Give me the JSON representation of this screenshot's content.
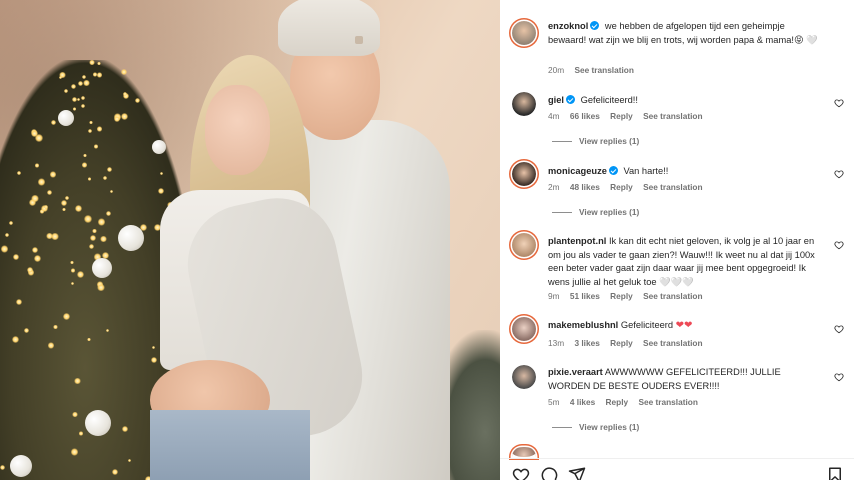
{
  "post": {
    "caption_user": "enzoknol",
    "caption_text": "we hebben de afgelopen tijd een geheimpje bewaard! wat zijn we blij en trots, wij worden papa & mama!😝 🤍",
    "caption_time": "20m",
    "see_translation": "See translation"
  },
  "comments": [
    {
      "user": "giel",
      "verified": true,
      "text": "Gefeliciteerd!!",
      "time": "4m",
      "likes": "66 likes",
      "reply": "Reply",
      "translate": "See translation",
      "view_replies": "View replies (1)"
    },
    {
      "user": "monicageuze",
      "verified": true,
      "text": "Van harte!!",
      "time": "2m",
      "likes": "48 likes",
      "reply": "Reply",
      "translate": "See translation",
      "view_replies": "View replies (1)"
    },
    {
      "user": "plantenpot.nl",
      "verified": false,
      "text": "Ik kan dit echt niet geloven, ik volg je al 10 jaar en om jou als vader te gaan zien?! Wauw!!! Ik weet nu al dat jij 100x een beter vader gaat zijn daar waar jij mee bent opgegroeid! Ik wens jullie al het geluk toe 🤍🤍🤍",
      "time": "9m",
      "likes": "51 likes",
      "reply": "Reply",
      "translate": "See translation"
    },
    {
      "user": "makemeblushnl",
      "verified": false,
      "text": "Gefeliciteerd",
      "hearts": "❤❤",
      "time": "13m",
      "likes": "3 likes",
      "reply": "Reply",
      "translate": "See translation"
    },
    {
      "user": "pixie.veraart",
      "verified": false,
      "text": "AWWWWWW GEFELICITEERD!!! JULLIE WORDEN DE BESTE OUDERS EVER!!!!",
      "time": "5m",
      "likes": "4 likes",
      "reply": "Reply",
      "translate": "See translation",
      "view_replies": "View replies (1)"
    }
  ],
  "icons": {
    "like": "heart-outline-icon",
    "comment": "comment-icon",
    "share": "share-icon",
    "save": "bookmark-icon"
  },
  "colors": {
    "verified": "#0095f6",
    "muted": "#737373",
    "text": "#262626",
    "heart_red": "#ed4956"
  }
}
